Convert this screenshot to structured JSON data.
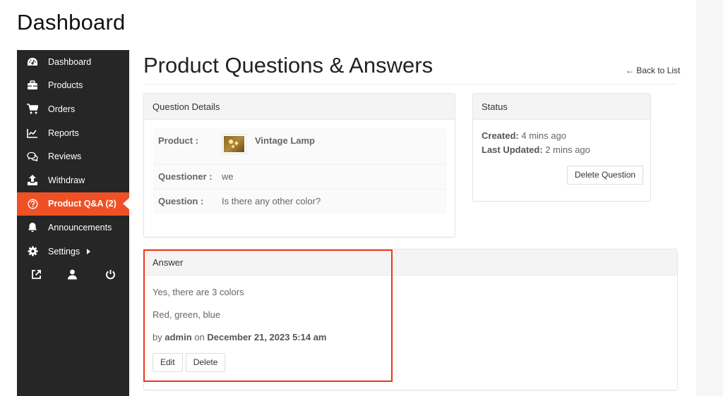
{
  "page": {
    "heading": "Dashboard"
  },
  "sidebar": {
    "items": [
      {
        "label": "Dashboard",
        "icon": "dashboard-gauge-icon"
      },
      {
        "label": "Products",
        "icon": "briefcase-icon"
      },
      {
        "label": "Orders",
        "icon": "shopping-cart-icon"
      },
      {
        "label": "Reports",
        "icon": "line-chart-icon"
      },
      {
        "label": "Reviews",
        "icon": "comments-icon"
      },
      {
        "label": "Withdraw",
        "icon": "upload-icon"
      },
      {
        "label": "Product Q&A (2)",
        "icon": "question-circle-icon",
        "active": true
      },
      {
        "label": "Announcements",
        "icon": "bell-icon"
      },
      {
        "label": "Settings",
        "icon": "gear-icon",
        "has_submenu": true
      }
    ],
    "bottom_icons": [
      "external-link-icon",
      "user-icon",
      "power-icon"
    ],
    "accent_color": "#f05025",
    "background_color": "#262626"
  },
  "main": {
    "title": "Product Questions & Answers",
    "back_link": "← Back to List",
    "question_details": {
      "heading": "Question Details",
      "rows": [
        {
          "label": "Product :",
          "value": "Vintage Lamp"
        },
        {
          "label": "Questioner :",
          "value": "we"
        },
        {
          "label": "Question :",
          "value": "Is there any other color?"
        }
      ]
    },
    "status": {
      "heading": "Status",
      "created_label": "Created:",
      "created_value": "4 mins ago",
      "updated_label": "Last Updated:",
      "updated_value": "2 mins ago",
      "delete_button": "Delete Question"
    },
    "answer": {
      "heading": "Answer",
      "lines": [
        "Yes, there are 3 colors",
        "Red, green, blue"
      ],
      "by_prefix": "by",
      "author": "admin",
      "on_text": "on",
      "date": "December 21, 2023 5:14 am",
      "edit_button": "Edit",
      "delete_button": "Delete",
      "highlight_color": "#f0361c"
    }
  }
}
